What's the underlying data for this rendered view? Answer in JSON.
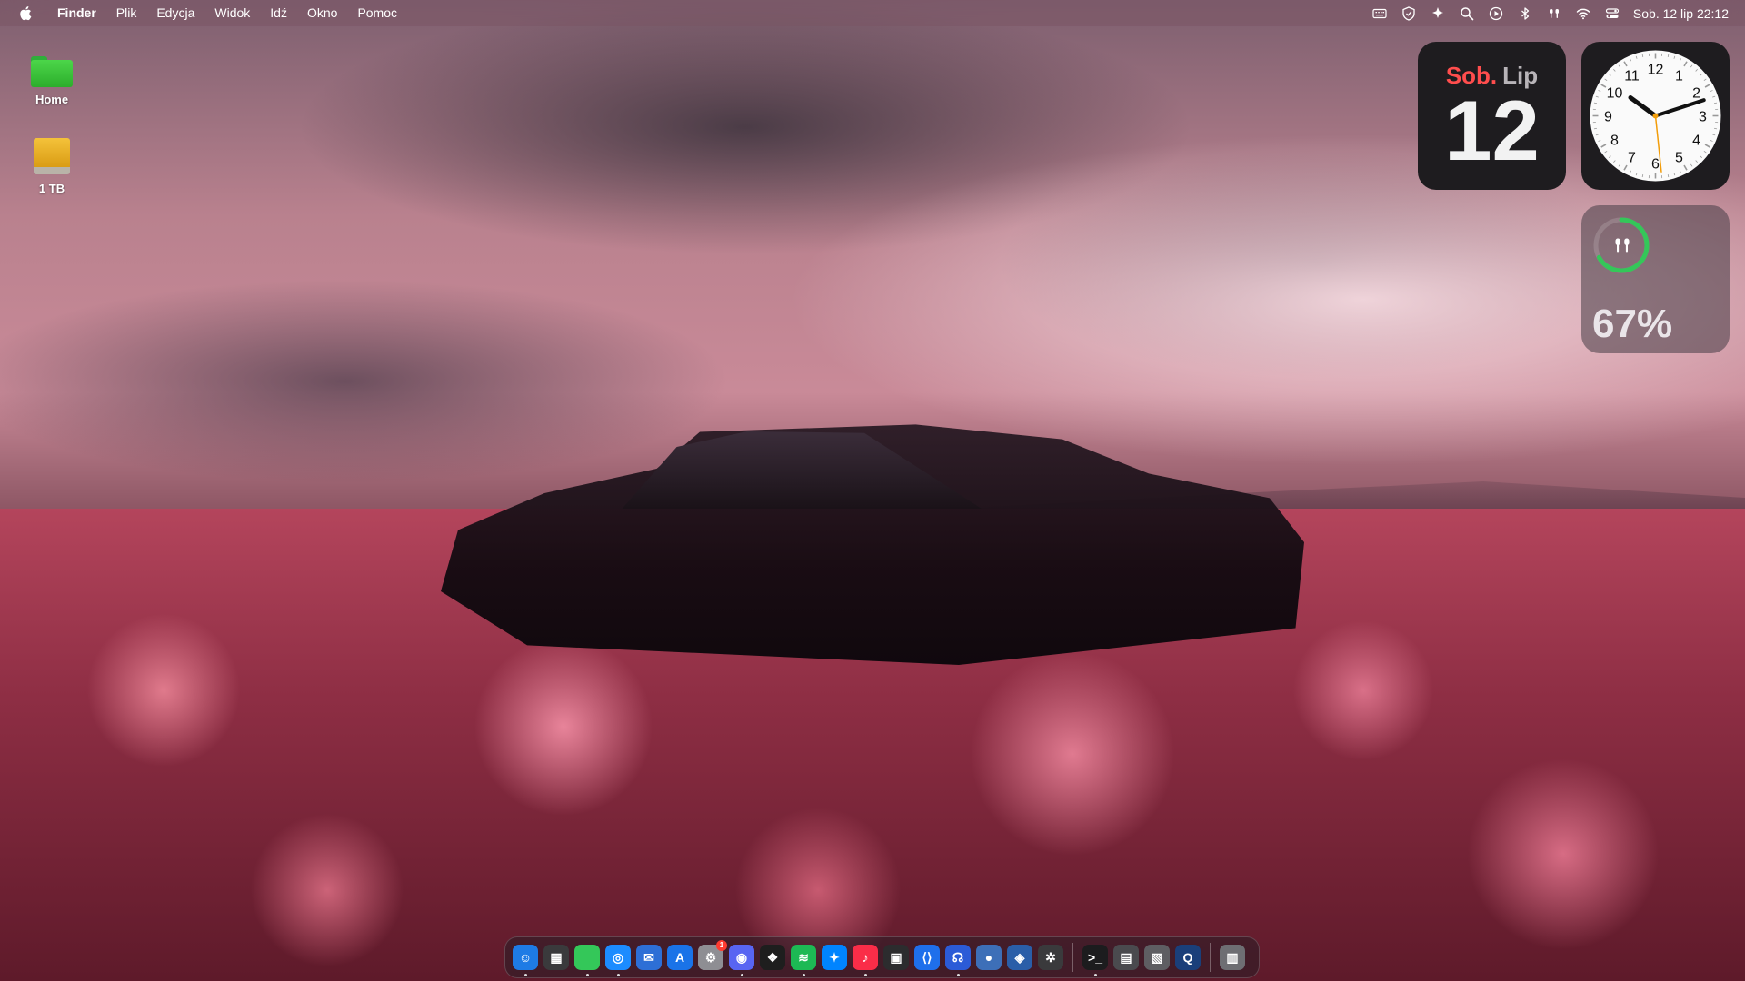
{
  "menubar": {
    "app_name": "Finder",
    "menus": [
      "Plik",
      "Edycja",
      "Widok",
      "Idź",
      "Okno",
      "Pomoc"
    ],
    "status_icons": [
      "keyboard-icon",
      "shield-icon",
      "sparkle-icon",
      "search-icon",
      "play-icon",
      "bluetooth-icon",
      "airpods-icon",
      "wifi-icon",
      "control-center-icon"
    ],
    "datetime": "Sob. 12 lip  22:12"
  },
  "desktop": {
    "icons": [
      {
        "label": "Home",
        "icon": "green-folder-icon"
      },
      {
        "label": "1 TB",
        "icon": "external-drive-icon"
      }
    ]
  },
  "widgets": {
    "calendar": {
      "dow": "Sob.",
      "month": "Lip",
      "day": "12",
      "dow_color": "#ff4d4d"
    },
    "clock": {
      "numbers": [
        "12",
        "1",
        "2",
        "3",
        "4",
        "5",
        "6",
        "7",
        "8",
        "9",
        "10",
        "11"
      ],
      "hour": 10,
      "minute": 12,
      "second": 29
    },
    "battery": {
      "percent": "67%",
      "level": 0.67,
      "device": "airpods-icon",
      "ring_color": "#34c759"
    }
  },
  "dock": {
    "apps": [
      {
        "name": "finder-icon",
        "color": "#1e7be5",
        "running": true
      },
      {
        "name": "launchpad-icon",
        "color": "#3a3a3c",
        "running": false
      },
      {
        "name": "folder-icon",
        "color": "#34c759",
        "running": true
      },
      {
        "name": "safari-icon",
        "color": "#1c8cff",
        "running": true
      },
      {
        "name": "mail-icon",
        "color": "#2d6fd6",
        "running": false
      },
      {
        "name": "app-store-icon",
        "color": "#1a73e8",
        "running": false
      },
      {
        "name": "system-settings-icon",
        "color": "#8e8e93",
        "running": false,
        "badge": "1"
      },
      {
        "name": "discord-icon",
        "color": "#5865f2",
        "running": true
      },
      {
        "name": "figma-icon",
        "color": "#1e1e1e",
        "running": false
      },
      {
        "name": "spotify-icon",
        "color": "#1db954",
        "running": true
      },
      {
        "name": "messenger-icon",
        "color": "#0084ff",
        "running": false
      },
      {
        "name": "music-icon",
        "color": "#fa2d48",
        "running": true
      },
      {
        "name": "camera-icon",
        "color": "#2c2c2e",
        "running": false
      },
      {
        "name": "vscode-icon",
        "color": "#1f6feb",
        "running": false
      },
      {
        "name": "support-icon",
        "color": "#2b5bd7",
        "running": true
      },
      {
        "name": "circle-app-icon",
        "color": "#3d6fb8",
        "running": false
      },
      {
        "name": "network-icon",
        "color": "#2a5ea8",
        "running": false
      },
      {
        "name": "chatgpt-icon",
        "color": "#3a3a3c",
        "running": false
      },
      {
        "name": "terminal-icon",
        "color": "#1c1c1e",
        "running": true
      },
      {
        "name": "activity-monitor-icon",
        "color": "#4a4a4e",
        "running": false
      },
      {
        "name": "preview-icon",
        "color": "#5e5e62",
        "running": false
      },
      {
        "name": "quicktime-icon",
        "color": "#1a3f7a",
        "running": false
      },
      {
        "name": "trash-icon",
        "color": "#6e6e73",
        "running": false
      }
    ]
  }
}
